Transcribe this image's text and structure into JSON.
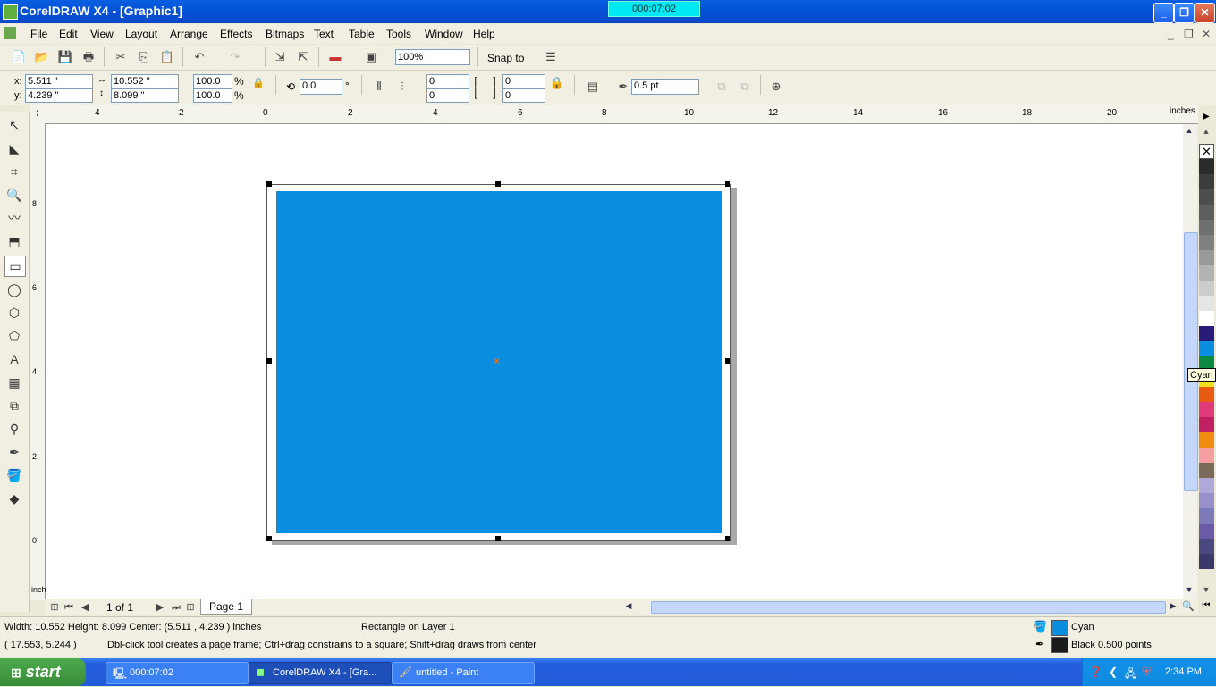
{
  "window": {
    "title": "CorelDRAW X4 - [Graphic1]",
    "timer": "000:07:02",
    "controls": {
      "minimize": "_",
      "restore": "❐",
      "close": "✕"
    }
  },
  "menubar": {
    "items": [
      "File",
      "Edit",
      "View",
      "Layout",
      "Arrange",
      "Effects",
      "Bitmaps",
      "Text",
      "Table",
      "Tools",
      "Window",
      "Help"
    ],
    "mdi_controls": [
      "_",
      "❐",
      "✕"
    ]
  },
  "toolbar": {
    "zoom": "100%",
    "snap_to": "Snap to"
  },
  "propbar": {
    "x_label": "x:",
    "y_label": "y:",
    "x": "5.511 \"",
    "y": "4.239 \"",
    "width": "10.552 \"",
    "height": "8.099 \"",
    "scale_w": "100.0",
    "scale_h": "100.0",
    "pct": "%",
    "rotation": "0.0",
    "deg": "°",
    "corner_tl": "0",
    "corner_bl": "0",
    "corner_tr": "0",
    "corner_br": "0",
    "outline": "0.5 pt"
  },
  "ruler": {
    "unit": "inches",
    "h_ticks": [
      "4",
      "2",
      "0",
      "2",
      "4",
      "6",
      "8",
      "10",
      "12",
      "14",
      "16",
      "18",
      "20"
    ],
    "v_ticks": [
      "8",
      "6",
      "4",
      "2",
      "0"
    ],
    "v_unit": "inches"
  },
  "canvas": {
    "fill_color": "#0b8ee0",
    "center_marker": "×"
  },
  "pagenav": {
    "counter": "1 of 1",
    "tab": "Page 1"
  },
  "palette": {
    "tooltip": "Cyan",
    "colors": [
      "#2a2a2a",
      "#3c3c3c",
      "#4d4d4d",
      "#5e5e5e",
      "#707070",
      "#808080",
      "#999999",
      "#b3b3b3",
      "#cccccc",
      "#e6e6e6",
      "#ffffff",
      "#2a1a7a",
      "#0b8ee0",
      "#0a8a40",
      "#f0e020",
      "#e85a10",
      "#e03a7a",
      "#c02060",
      "#f08a10",
      "#f4a0a0",
      "#7a6a5a",
      "#b0a8d8",
      "#9890c8",
      "#7c7ab8",
      "#6a5aa8",
      "#4a4a80",
      "#3a3a6a"
    ]
  },
  "status": {
    "dimensions": "Width: 10.552  Height: 8.099  Center: (5.511 , 4.239 )  inches",
    "object": "Rectangle on Layer 1",
    "cursor": "( 17.553, 5.244  )",
    "hint": "Dbl-click tool creates a page frame; Ctrl+drag constrains to a square; Shift+drag draws from center",
    "fill_name": "Cyan",
    "fill_color": "#0b8ee0",
    "outline_desc": "Black  0.500 points",
    "outline_color": "#1a1a1a"
  },
  "taskbar": {
    "start": "start",
    "tasks": [
      "000:07:02",
      "CorelDRAW X4 - [Gra...",
      "untitled - Paint"
    ],
    "clock": "2:34 PM"
  }
}
